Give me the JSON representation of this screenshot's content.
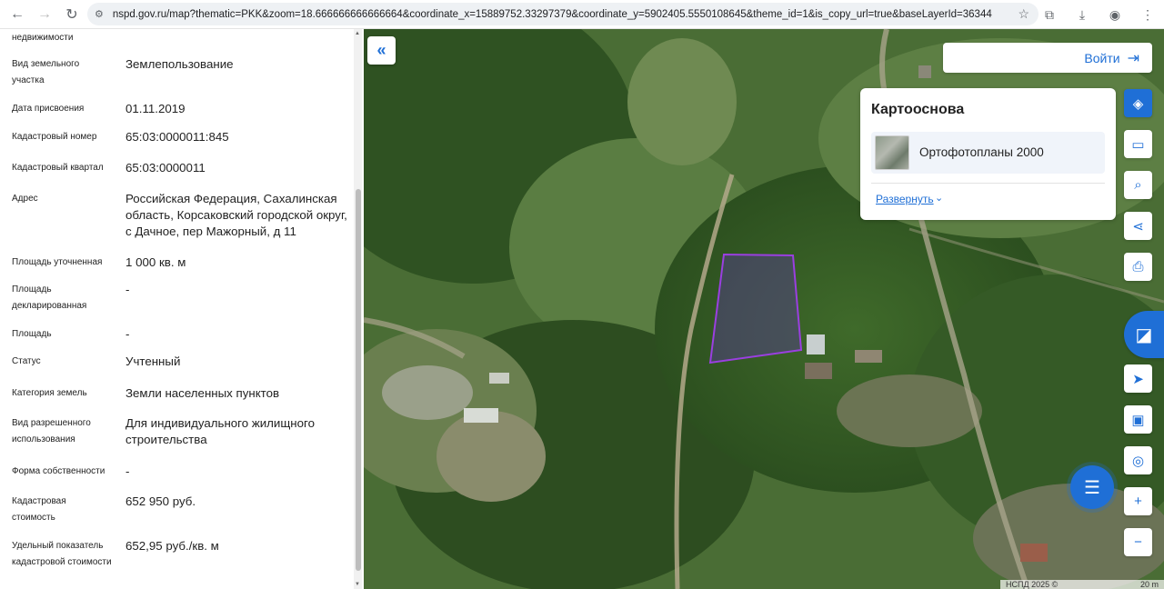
{
  "browser": {
    "url": "nspd.gov.ru/map?thematic=PKK&zoom=18.666666666666664&coordinate_x=15889752.33297379&coordinate_y=5902405.5550108645&theme_id=1&is_copy_url=true&baseLayerId=36344"
  },
  "panel": {
    "partial_top_label": "недвижимости",
    "rows": [
      {
        "label": "Вид земельного участка",
        "value": "Землепользование"
      },
      {
        "label": "Дата присвоения",
        "value": "01.11.2019"
      },
      {
        "label": "Кадастровый номер",
        "value": "65:03:0000011:845"
      },
      {
        "label": "Кадастровый квартал",
        "value": "65:03:0000011"
      },
      {
        "label": "Адрес",
        "value": "Российская Федерация, Сахалинская область, Корсаковский городской округ, с Дачное, пер Мажорный, д 11"
      },
      {
        "label": "Площадь уточненная",
        "value": "1 000 кв. м"
      },
      {
        "label": "Площадь декларированная",
        "value": "-"
      },
      {
        "label": "Площадь",
        "value": "-"
      },
      {
        "label": "Статус",
        "value": "Учтенный"
      },
      {
        "label": "Категория земель",
        "value": "Земли населенных пунктов"
      },
      {
        "label": "Вид разрешенного использования",
        "value": "Для индивидуального жилищного строительства"
      },
      {
        "label": "Форма собственности",
        "value": "-"
      },
      {
        "label": "Кадастровая стоимость",
        "value": "652 950 руб."
      },
      {
        "label": "Удельный показатель кадастровой стоимости",
        "value": "652,95 руб./кв. м"
      }
    ]
  },
  "map": {
    "login_label": "Войти",
    "basemap_title": "Картооснова",
    "basemap_layer": "Ортофотопланы 2000",
    "expand_label": "Развернуть",
    "footer_copyright": "НСПД 2025 ©",
    "footer_scale": "20 m",
    "parcel_color": "#8a2be2"
  }
}
